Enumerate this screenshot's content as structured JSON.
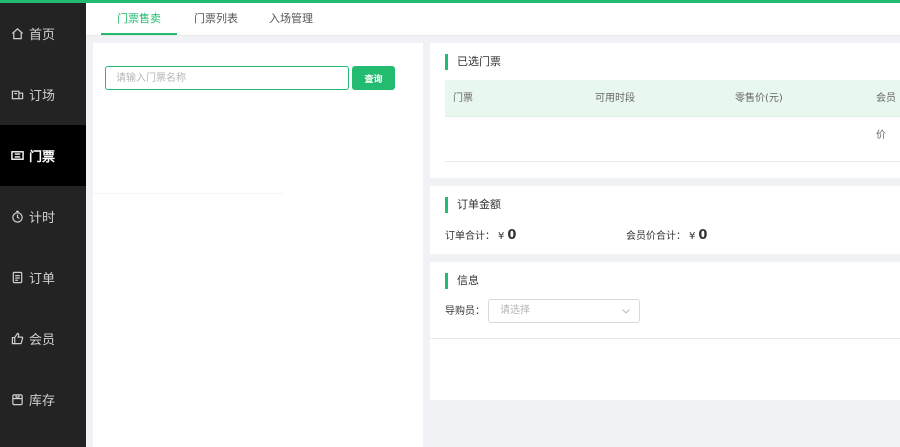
{
  "sidebar": {
    "items": [
      {
        "label": "首页",
        "icon": "home-icon"
      },
      {
        "label": "订场",
        "icon": "venue-icon"
      },
      {
        "label": "门票",
        "icon": "ticket-icon"
      },
      {
        "label": "计时",
        "icon": "timer-icon"
      },
      {
        "label": "订单",
        "icon": "order-icon"
      },
      {
        "label": "会员",
        "icon": "member-icon"
      },
      {
        "label": "库存",
        "icon": "inventory-icon"
      }
    ],
    "active": "门票"
  },
  "tabs": [
    {
      "label": "门票售卖"
    },
    {
      "label": "门票列表"
    },
    {
      "label": "入场管理"
    }
  ],
  "search": {
    "placeholder": "请输入门票名称",
    "value": "",
    "button_label": "查询"
  },
  "selected_tickets": {
    "title": "已选门票",
    "columns": [
      "门票",
      "可用时段",
      "零售价(元)",
      "会员价"
    ]
  },
  "order_amount": {
    "title": "订单金额",
    "total_label": "订单合计：",
    "total_currency": "¥",
    "total_value": "0",
    "member_total_label": "会员价合计：",
    "member_currency": "¥",
    "member_total_value": "0"
  },
  "info": {
    "title": "信息",
    "guide_label": "导购员：",
    "guide_placeholder": "请选择"
  },
  "colors": {
    "accent": "#22bb6f",
    "sidebar_bg": "#232323",
    "sidebar_active_bg": "#000000",
    "table_head_bg": "#e9f8ef"
  }
}
